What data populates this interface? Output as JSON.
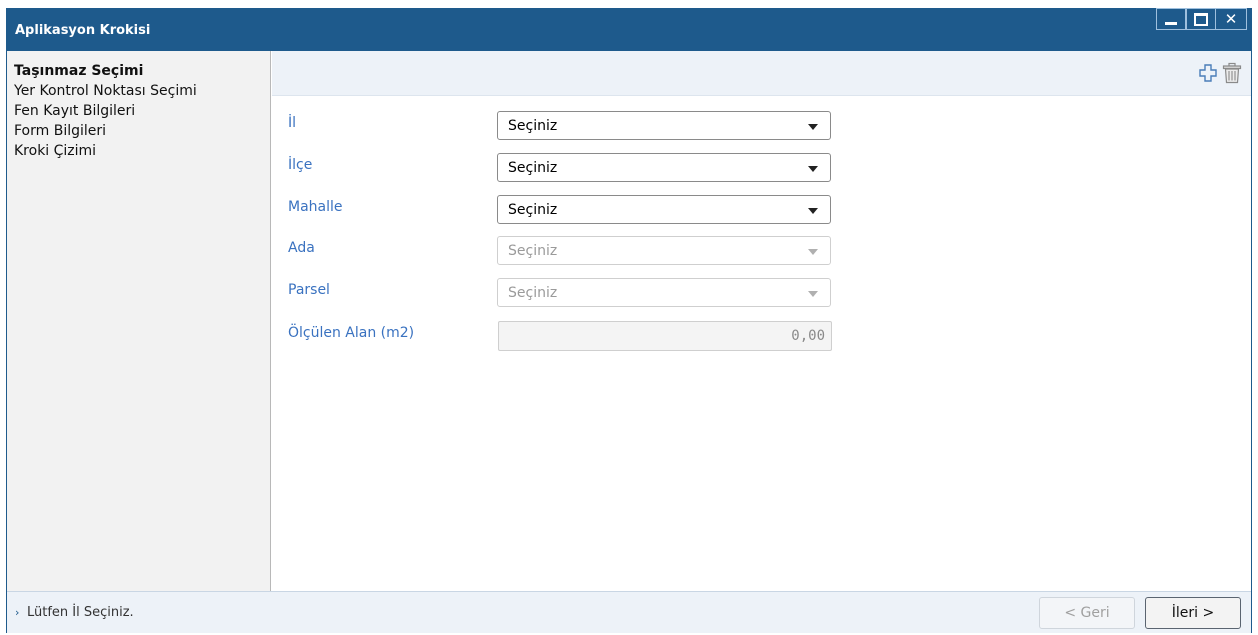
{
  "window": {
    "title": "Aplikasyon Krokisi",
    "controls": [
      "minimize-icon",
      "maximize-icon",
      "close-icon"
    ],
    "close_glyph": "✕"
  },
  "sidebar": {
    "items": [
      {
        "label": "Taşınmaz Seçimi",
        "active": true
      },
      {
        "label": "Yer Kontrol Noktası Seçimi",
        "active": false
      },
      {
        "label": "Fen Kayıt Bilgileri",
        "active": false
      },
      {
        "label": "Form Bilgileri",
        "active": false
      },
      {
        "label": "Kroki Çizimi",
        "active": false
      }
    ]
  },
  "toolbar": {
    "icons": [
      "add-icon",
      "trash-icon"
    ]
  },
  "form": {
    "il": {
      "label": "İl",
      "value": "Seçiniz",
      "enabled": true
    },
    "ilce": {
      "label": "İlçe",
      "value": "Seçiniz",
      "enabled": true
    },
    "mahalle": {
      "label": "Mahalle",
      "value": "Seçiniz",
      "enabled": true
    },
    "ada": {
      "label": "Ada",
      "value": "Seçiniz",
      "enabled": false
    },
    "parsel": {
      "label": "Parsel",
      "value": "Seçiniz",
      "enabled": false
    },
    "alan": {
      "label": "Ölçülen Alan (m2)",
      "value": "0,00",
      "enabled": false
    }
  },
  "status": {
    "arrow": "›",
    "message": "Lütfen İl Seçiniz.",
    "back_label": "< Geri",
    "next_label": "İleri >"
  },
  "colors": {
    "titlebar": "#1e5a8c",
    "label_blue": "#3a72c0",
    "sidebar_bg": "#f2f2f2",
    "toolbar_bg": "#edf2f8"
  }
}
